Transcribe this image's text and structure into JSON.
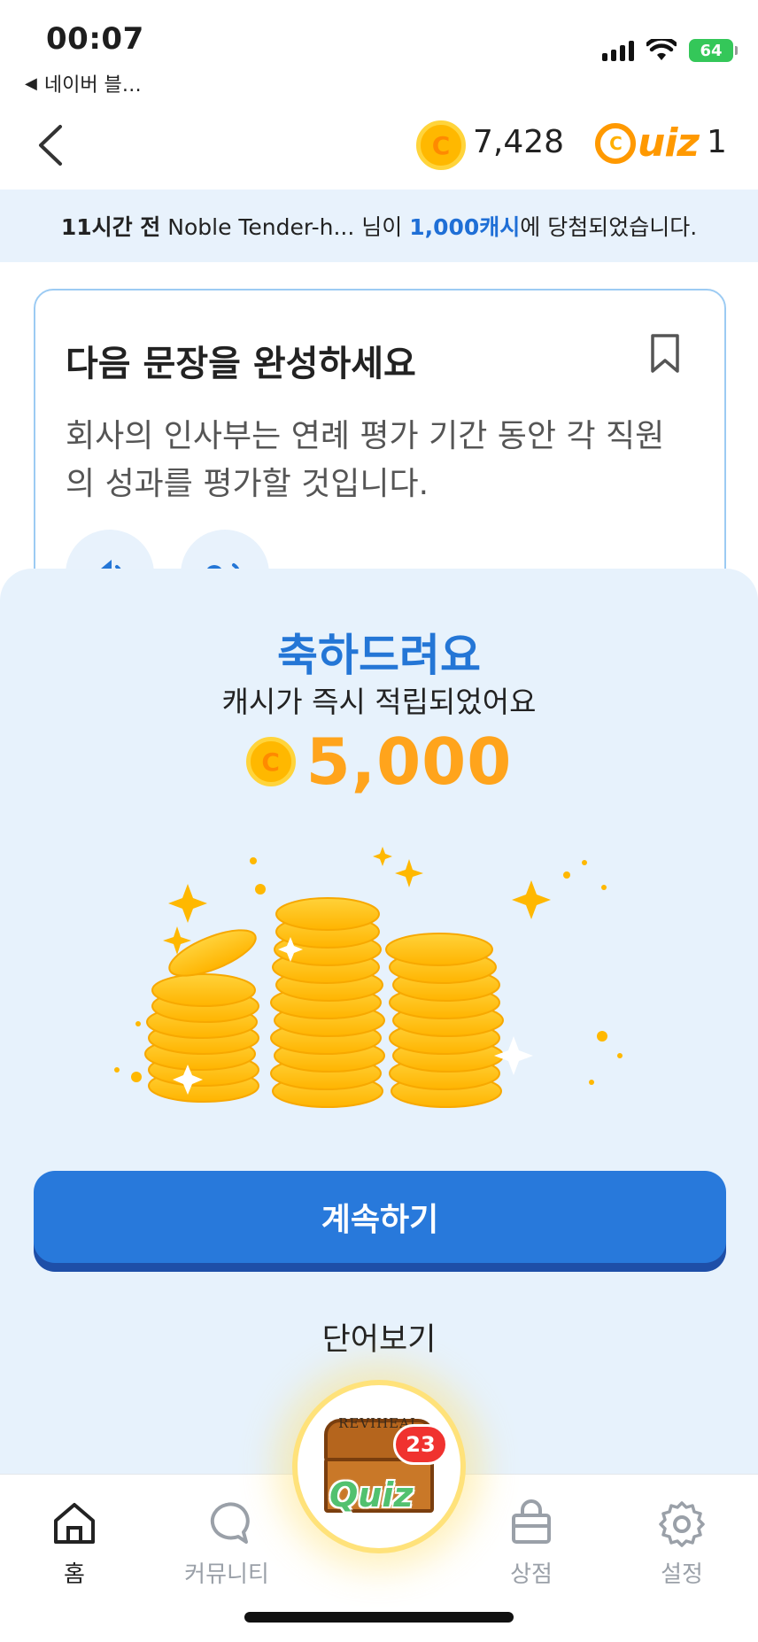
{
  "status_bar": {
    "time": "00:07",
    "back_app": "네이버 블…",
    "battery": "64"
  },
  "header": {
    "cash": "7,428",
    "quiz_label": "uiz",
    "quiz_q": "C",
    "quiz_count": "1",
    "coin_symbol": "C"
  },
  "ticker": {
    "time_ago": "11시간 전",
    "user": " Noble Tender-h... 님이 ",
    "amount": "1,000캐시",
    "suffix": "에 당첨되었습니다."
  },
  "quiz_card": {
    "title": "다음 문장을 완성하세요",
    "sentence": "회사의 인사부는 연례 평가 기간 동안 각 직원의 성과를 평가할 것입니다."
  },
  "reward": {
    "title": "축하드려요",
    "subtitle": "캐시가 즉시 적립되었어요",
    "coin_symbol": "C",
    "amount": "5,000"
  },
  "actions": {
    "continue_label": "계속하기",
    "view_words_label": "단어보기"
  },
  "bottom_nav": {
    "items": [
      {
        "label": "홈",
        "icon": "home-icon"
      },
      {
        "label": "커뮤니티",
        "icon": "chat-bubble-icon"
      },
      {
        "label": "상점",
        "icon": "shopping-bag-icon"
      },
      {
        "label": "설정",
        "icon": "gear-icon"
      }
    ],
    "center": {
      "brand_text": "REVIHEAL",
      "quiz_text": "Quiz",
      "badge": "23"
    }
  },
  "colors": {
    "accent_blue": "#2879db",
    "coin_orange": "#ffa41c",
    "sheet_bg": "#e7f2fc",
    "badge_red": "#f0322f"
  }
}
